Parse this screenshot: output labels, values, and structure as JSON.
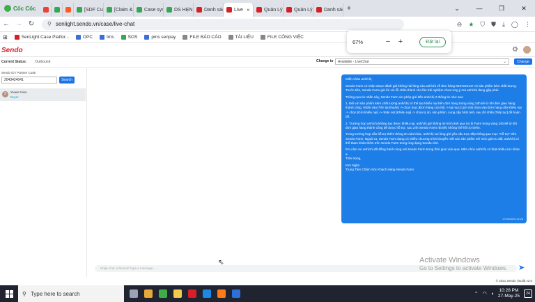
{
  "browser": {
    "brand": "Cốc Cốc",
    "tabs": [
      {
        "label": "",
        "color": "#ea4335"
      },
      {
        "label": "",
        "color": "#34a853"
      },
      {
        "label": "",
        "color": "#ff5a1f"
      },
      {
        "label": "[SDF Cus",
        "color": "#34a853"
      },
      {
        "label": "[Claim &",
        "color": "#34a853"
      },
      {
        "label": "Case syst",
        "color": "#34a853"
      },
      {
        "label": "DS HẸN",
        "color": "#34a853"
      },
      {
        "label": "Danh sác",
        "color": "#d81f26"
      },
      {
        "label": "Live",
        "color": "#d81f26",
        "active": true
      },
      {
        "label": "Quản Lý",
        "color": "#d81f26"
      },
      {
        "label": "Quản Lý",
        "color": "#d81f26"
      },
      {
        "label": "Danh sác",
        "color": "#d81f26"
      }
    ],
    "new_tab": "+",
    "url": "senlight.sendo.vn/case/live-chat",
    "bookmarks": [
      {
        "label": "SenLight Case Platfor...",
        "color": "#d81f26"
      },
      {
        "label": "OPC",
        "color": "#3b6fd8"
      },
      {
        "label": "tms",
        "color": "#3b6fd8"
      },
      {
        "label": "SOS",
        "color": "#34a853"
      },
      {
        "label": "pms senpay",
        "color": "#3b6fd8"
      },
      {
        "label": "FILE BÁO CÁO",
        "color": "#888888"
      },
      {
        "label": "TÀI LIỆU",
        "color": "#888888"
      },
      {
        "label": "FILE CÔNG VIỆC",
        "color": "#888888"
      }
    ],
    "zoom": {
      "value": "67%",
      "minus": "−",
      "plus": "+",
      "reset": "Đặt lại"
    }
  },
  "app": {
    "logo": "Sendo",
    "current_status_label": "Current Status:",
    "current_status": "Outbound",
    "change_to_label": "Change to",
    "change_to_value": "Available - LiveChat",
    "change_button": "Change",
    "partner_label": "Sendo ID / Partner Code",
    "search_value": "2043424041",
    "search_button": "Search",
    "conversation": {
      "initial": "X",
      "name": "Xuaan Hieu",
      "status": "Buyer"
    },
    "message": {
      "paragraphs": [
        "Miền chào anh/chị,",
        "Sendo Farm có nhận được đánh giá không hài lòng của anh/chị về đơn hàng 8437225147 có sản phẩm kém chất lượng. Trước tiên, Sendo Farm gửi lời xin lỗi chân thành cho lần trải nghiệm chưa ưng ý mà anh/chị đang gặp phải.",
        "Thông qua tin nhắn này, Sendo Farm xin phép gửi đến anh/chị 2 thông tin như sau:",
        "1. Đối với sản phẩm kém chất lượng anh/chị có thể tạo khiếu nại trên đơn hàng trong vòng 24h kể từ khi đơn giao hàng thành công. Nhấn vào [Tên tài khoản] -> chọn mục [Đơn hàng của tôi] -> tại mục [Lịch sử] chọn vào Đơn hàng cần khiếu nại -> chọn [Gửi khiếu nại] -> nhấn nút [Khiếu nại] -> chọn lý do, sản phẩm, cung cấp hình ảnh, sau đó nhấn [Tiếp tục] để hoàn tất.",
        "2. Trường hợp anh/chị không tạo được khiếu nại, anh/chị gửi thông tin hình ảnh qua trợ lý Farm trong vòng 24h kể từ khi đơn giao hàng thành công để được hỗ trợ, sau 24h Sendo Farm rất tiếc không thể hỗ trợ thêm.",
        "Trong trường hợp cần hỗ trợ thêm thông tin nào khác, anh/chị vui lòng gửi yêu cầu trực tiếp thông qua mục \"Hỗ trợ\" trên Sendo Farm. Ngoài ra, Sendo Farm đang có nhiều chương trình khuyến mãi các sản phẩm với mức giá ưu đãi, anh/chị có thể tham khảo thêm trên Sendo Farm trong ứng dụng Sendo nhé.",
        "Em cảm ơn anh/chị đã đồng hành cùng với Sendo Farm trong thời gian vừa qua. Mến chúc anh/chị có thật nhiều sức khỏe ạ.\nTrân trọng,",
        "Kim Ngân\nTrung Tâm Chăm Sóc Khách Hàng Sendo Farm"
      ],
      "timestamp": "27/05/2025 22:28"
    },
    "composer_placeholder": "Nhập chat cuốnmail/ Type a message...",
    "footer": "© 2021 Sendo | Build v3.0"
  },
  "watermark": {
    "line1": "Activate Windows",
    "line2": "Go to Settings to activate Windows."
  },
  "taskbar": {
    "search_placeholder": "Type here to search",
    "apps": [
      "#9aa3b5",
      "#e8a83a",
      "#3fae49",
      "#f2c94c",
      "#d81f26",
      "#1e88e5",
      "#ff7a1a",
      "#2f6fd8"
    ],
    "time": "10:28 PM",
    "date": "27-May-25",
    "notifications": "24"
  }
}
